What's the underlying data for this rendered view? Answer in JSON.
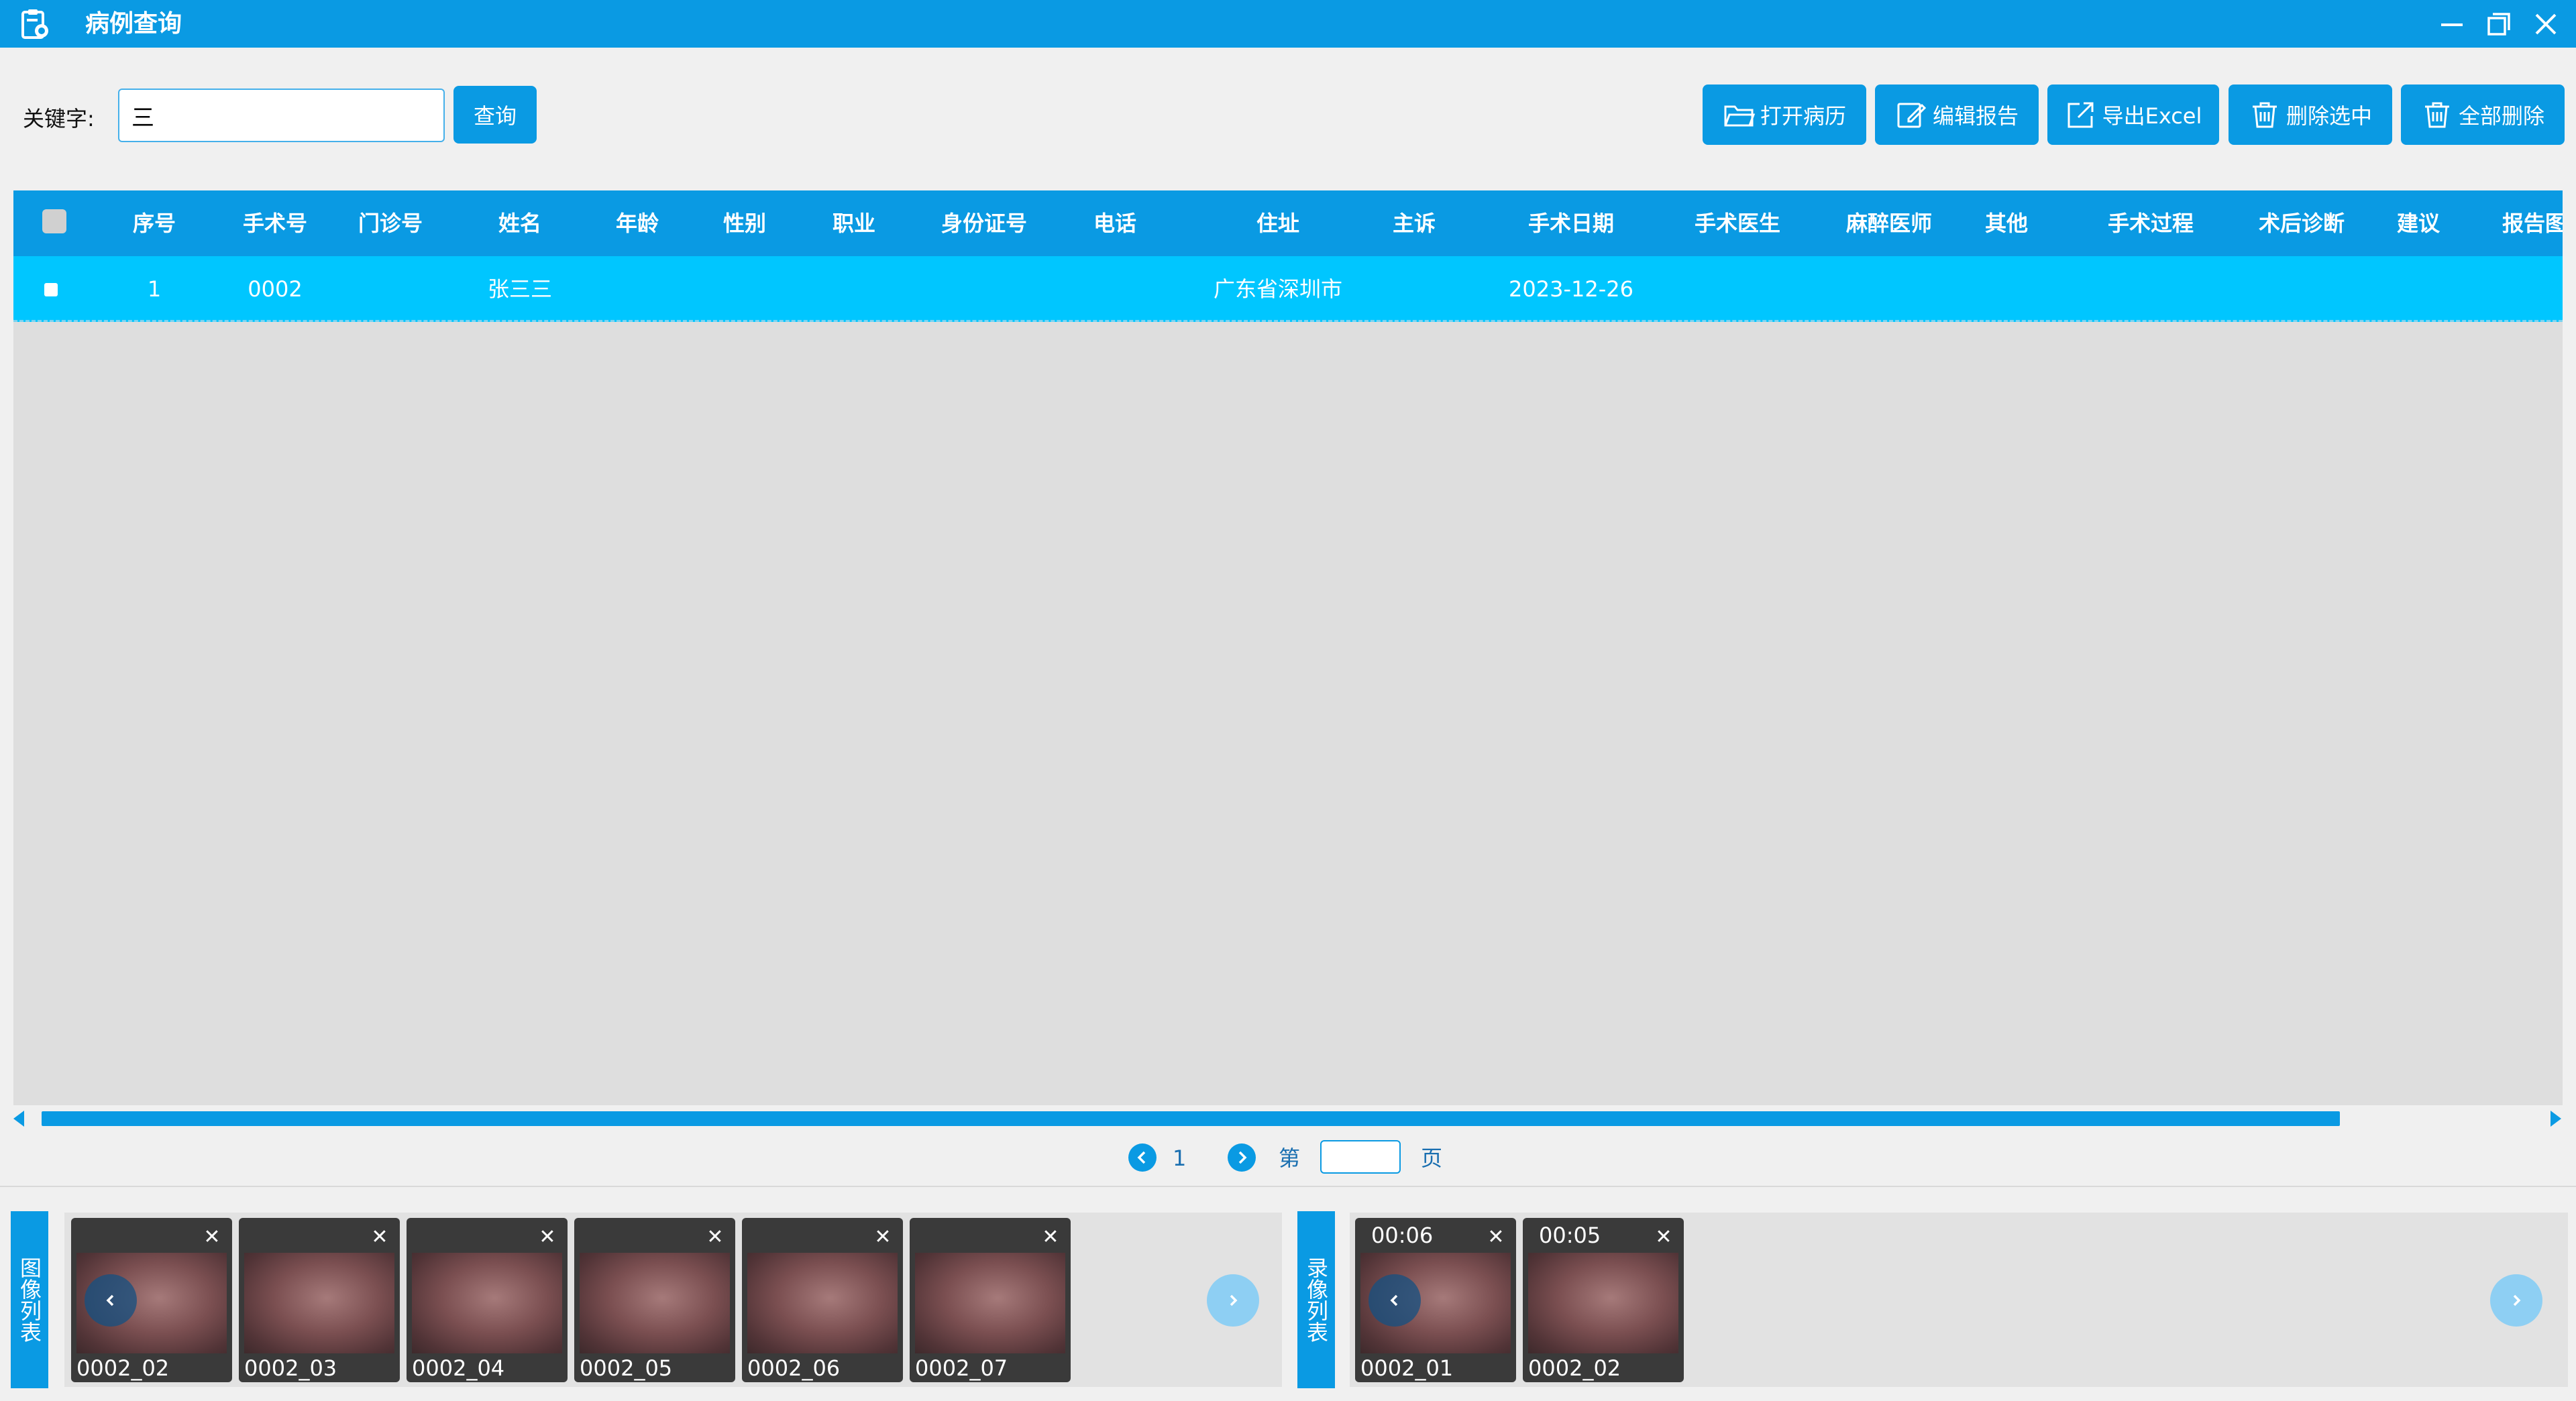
{
  "window": {
    "title": "病例查询",
    "controls": [
      "minimize-icon",
      "restore-icon",
      "close-icon"
    ]
  },
  "search": {
    "label": "关键字:",
    "value": "三",
    "button": "查询"
  },
  "toolbar": {
    "open_record": "打开病历",
    "edit_report": "编辑报告",
    "export_excel": "导出Excel",
    "delete_selected": "删除选中",
    "delete_all": "全部删除"
  },
  "table": {
    "columns": [
      "序号",
      "手术号",
      "门诊号",
      "姓名",
      "年龄",
      "性别",
      "职业",
      "身份证号",
      "电话",
      "住址",
      "主诉",
      "手术日期",
      "手术医生",
      "麻醉医师",
      "其他",
      "手术过程",
      "术后诊断",
      "建议",
      "报告图"
    ],
    "rows": [
      {
        "seq": "1",
        "surgery_no": "0002",
        "outpatient_no": "",
        "name": "张三三",
        "age": "",
        "gender": "",
        "occupation": "",
        "id_no": "",
        "phone": "",
        "address": "广东省深圳市",
        "complaint": "",
        "surgery_date": "2023-12-26"
      }
    ]
  },
  "pagination": {
    "current": "1",
    "prefix": "第",
    "suffix": "页",
    "page_input": ""
  },
  "image_list": {
    "label": "图像列表",
    "items": [
      {
        "name": "0002_02"
      },
      {
        "name": "0002_03"
      },
      {
        "name": "0002_04"
      },
      {
        "name": "0002_05"
      },
      {
        "name": "0002_06"
      },
      {
        "name": "0002_07"
      }
    ]
  },
  "video_list": {
    "label": "录像列表",
    "items": [
      {
        "name": "0002_01",
        "duration": "00:06"
      },
      {
        "name": "0002_02",
        "duration": "00:05"
      }
    ]
  },
  "colors": {
    "primary": "#0a9ae3",
    "row_selected": "#00c6ff",
    "grid_bg": "#dedede"
  }
}
